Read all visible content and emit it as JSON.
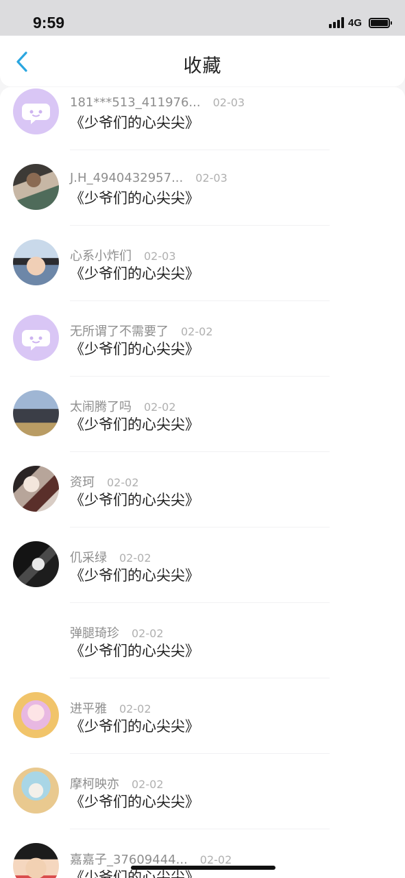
{
  "status_bar": {
    "time": "9:59",
    "network": "4G"
  },
  "nav": {
    "title": "收藏"
  },
  "favorites": [
    {
      "user": "181***513_411976...",
      "date": "02-03",
      "title": "《少爷们的心尖尖》",
      "avatar": "chat-bubble-avatar"
    },
    {
      "user": "J.H_4940432957...",
      "date": "02-03",
      "title": "《少爷们的心尖尖》",
      "avatar": "photo-avatar"
    },
    {
      "user": "心系小炸们",
      "date": "02-03",
      "title": "《少爷们的心尖尖》",
      "avatar": "photo-avatar"
    },
    {
      "user": "无所谓了不需要了",
      "date": "02-02",
      "title": "《少爷们的心尖尖》",
      "avatar": "chat-bubble-avatar"
    },
    {
      "user": "太闹腾了吗",
      "date": "02-02",
      "title": "《少爷们的心尖尖》",
      "avatar": "photo-avatar"
    },
    {
      "user": "资珂",
      "date": "02-02",
      "title": "《少爷们的心尖尖》",
      "avatar": "photo-avatar"
    },
    {
      "user": "仉采绿",
      "date": "02-02",
      "title": "《少爷们的心尖尖》",
      "avatar": "photo-avatar"
    },
    {
      "user": "弹腿琦珍",
      "date": "02-02",
      "title": "《少爷们的心尖尖》",
      "avatar": "none"
    },
    {
      "user": "进平雅",
      "date": "02-02",
      "title": "《少爷们的心尖尖》",
      "avatar": "photo-avatar"
    },
    {
      "user": "摩柯映亦",
      "date": "02-02",
      "title": "《少爷们的心尖尖》",
      "avatar": "photo-avatar"
    },
    {
      "user": "嘉嘉子_37609444...",
      "date": "02-02",
      "title": "《少爷们的心尖尖》",
      "avatar": "photo-avatar"
    }
  ],
  "colors": {
    "accent": "#2aa6e0",
    "placeholder_avatar": "#d9c6f5"
  }
}
